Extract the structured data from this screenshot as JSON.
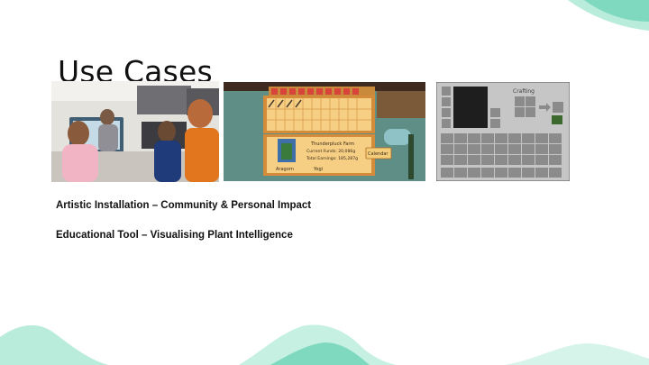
{
  "slide": {
    "title": "Use Cases"
  },
  "bullets": [
    {
      "text": "Artistic Installation – Community & Personal Impact"
    },
    {
      "text": "Educational Tool – Visualising Plant Intelligence"
    }
  ],
  "game_screenshot": {
    "farm_name": "Thunderpluck Farm",
    "current_funds": "Current Funds: 20,086g",
    "total_earnings": "Total Earnings: 185,287g",
    "player_name": "Aragorn",
    "pet_name": "Yogi",
    "calendar_label": "Calendar"
  },
  "crafting_screenshot": {
    "title": "Crafting"
  },
  "colors": {
    "accent_teal": "#7fd9bf",
    "accent_teal_light": "#b9ecdb",
    "text": "#111111"
  }
}
